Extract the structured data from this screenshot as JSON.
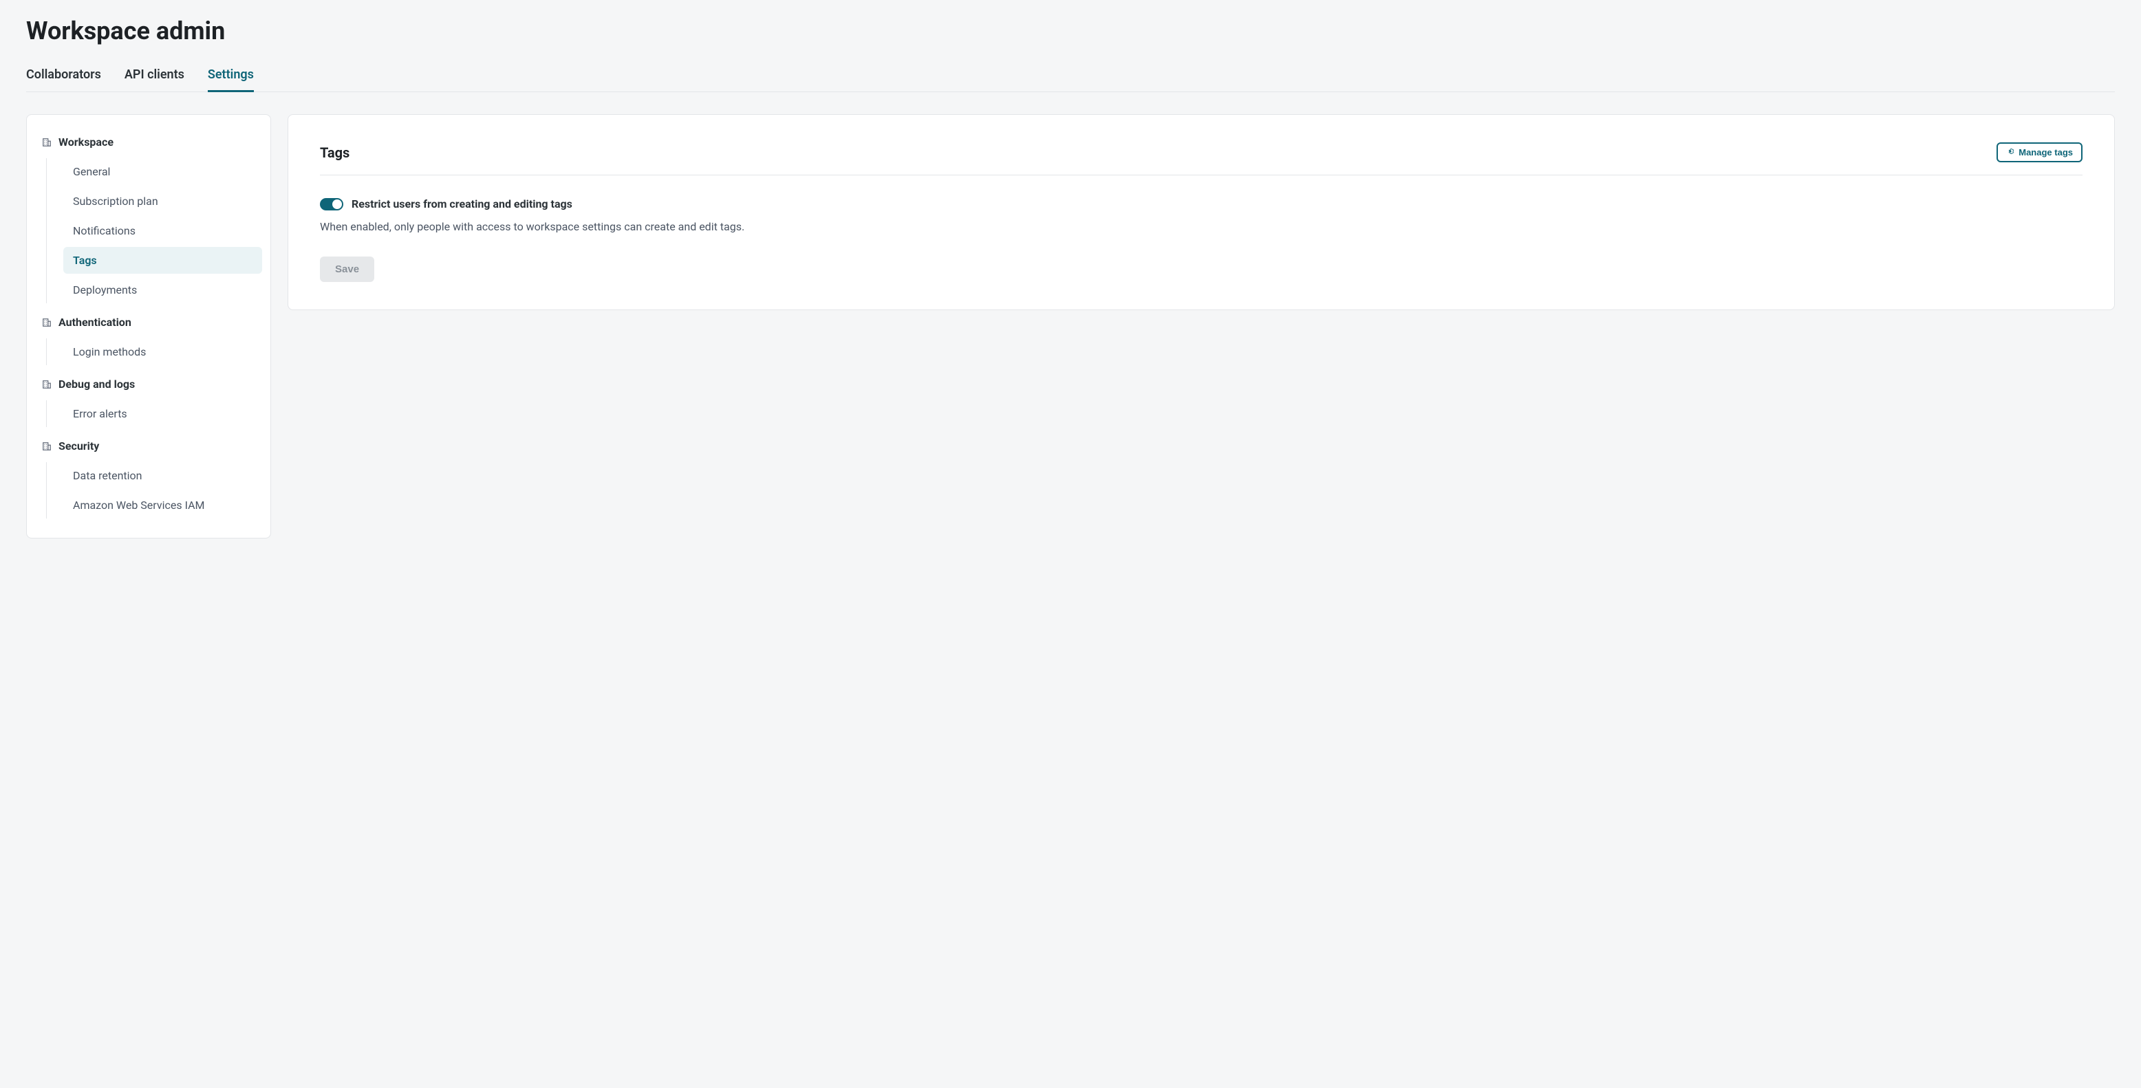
{
  "page": {
    "title": "Workspace admin"
  },
  "tabs": [
    {
      "label": "Collaborators",
      "active": false
    },
    {
      "label": "API clients",
      "active": false
    },
    {
      "label": "Settings",
      "active": true
    }
  ],
  "sidebar": {
    "groups": [
      {
        "label": "Workspace",
        "items": [
          {
            "label": "General",
            "active": false
          },
          {
            "label": "Subscription plan",
            "active": false
          },
          {
            "label": "Notifications",
            "active": false
          },
          {
            "label": "Tags",
            "active": true
          },
          {
            "label": "Deployments",
            "active": false
          }
        ]
      },
      {
        "label": "Authentication",
        "items": [
          {
            "label": "Login methods",
            "active": false
          }
        ]
      },
      {
        "label": "Debug and logs",
        "items": [
          {
            "label": "Error alerts",
            "active": false
          }
        ]
      },
      {
        "label": "Security",
        "items": [
          {
            "label": "Data retention",
            "active": false
          },
          {
            "label": "Amazon Web Services IAM",
            "active": false
          }
        ]
      }
    ]
  },
  "content": {
    "title": "Tags",
    "manage_button": "Manage tags",
    "toggle": {
      "label": "Restrict users from creating and editing tags",
      "enabled": true
    },
    "description": "When enabled, only people with access to workspace settings can create and edit tags.",
    "save_button": "Save"
  }
}
